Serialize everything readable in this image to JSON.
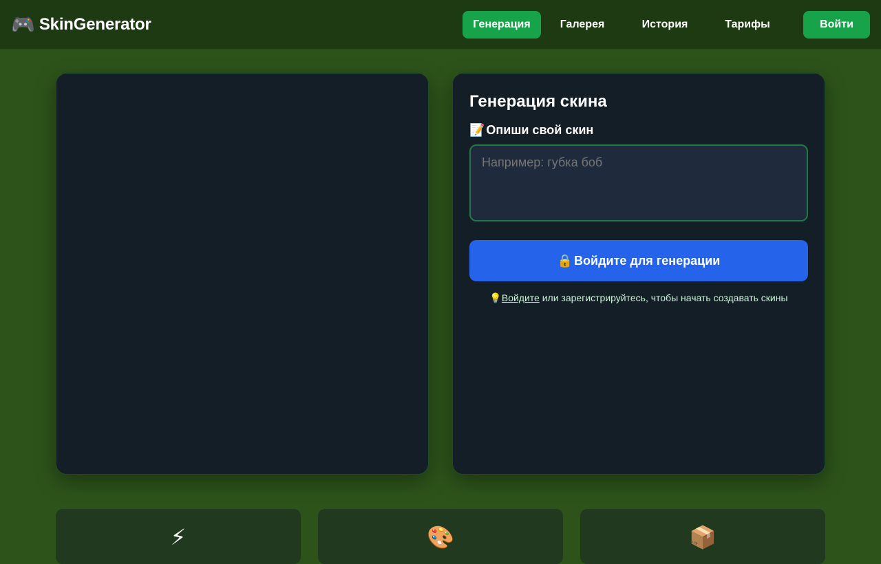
{
  "header": {
    "logo_icon": "🎮",
    "brand": "SkinGenerator",
    "nav": [
      {
        "label": "Генерация",
        "active": true
      },
      {
        "label": "Галерея"
      },
      {
        "label": "История"
      },
      {
        "label": "Тарифы"
      }
    ],
    "login_label": "Войти"
  },
  "form": {
    "title": "Генерация скина",
    "label_icon": "📝",
    "label": "Опиши свой скин",
    "placeholder": "Например: губка боб",
    "button_icon": "🔒",
    "button_label": "Войдите для генерации",
    "hint_icon": "💡",
    "hint_link": "Войдите",
    "hint_text": " или зарегистрируйтесь, чтобы начать создавать скины"
  },
  "features": [
    {
      "icon": "⚡"
    },
    {
      "icon": "🎨"
    },
    {
      "icon": "📦"
    }
  ],
  "colors": {
    "accent_green": "#16a34a",
    "primary_blue": "#2563eb",
    "background": "#2d531a",
    "panel": "#141e26"
  }
}
